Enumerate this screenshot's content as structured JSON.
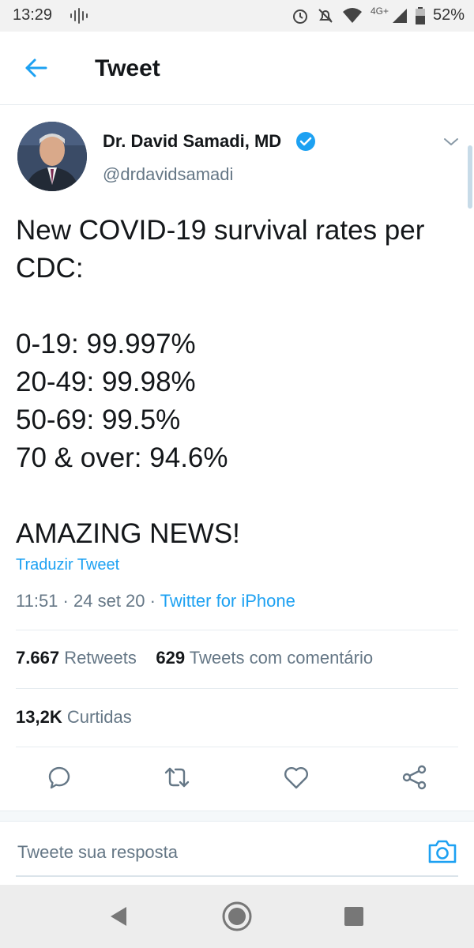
{
  "status_bar": {
    "time": "13:29",
    "network": "4G+",
    "battery": "52%"
  },
  "header": {
    "title": "Tweet"
  },
  "tweet": {
    "author_name": "Dr. David Samadi, MD",
    "handle": "@drdavidsamadi",
    "text_lines": [
      "New COVID-19 survival rates per",
      "CDC:",
      "",
      "0-19: 99.997%",
      "20-49: 99.98%",
      "50-69: 99.5%",
      "70 & over: 94.6%",
      "",
      "AMAZING NEWS!"
    ],
    "translate_label": "Traduzir Tweet",
    "time": "11:51",
    "date": "24 set 20",
    "source": "Twitter for iPhone"
  },
  "stats": {
    "retweets_count": "7.667",
    "retweets_label": "Retweets",
    "quotes_count": "629",
    "quotes_label": "Tweets com comentário",
    "likes_count": "13,2K",
    "likes_label": "Curtidas"
  },
  "reply": {
    "placeholder": "Tweete sua resposta"
  },
  "colors": {
    "accent": "#1da1f2",
    "text": "#14171a",
    "secondary": "#657786"
  }
}
